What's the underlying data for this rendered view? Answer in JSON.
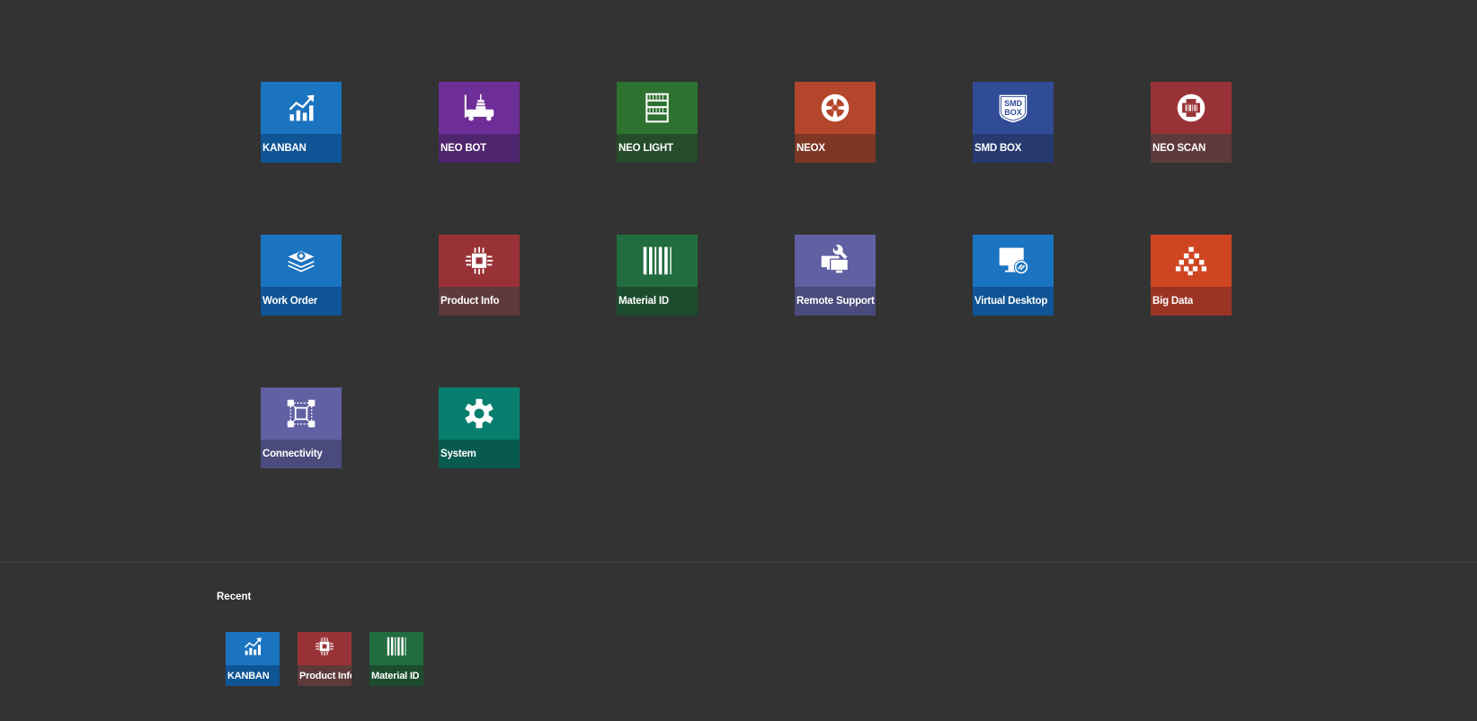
{
  "apps": [
    {
      "id": "kanban",
      "label": "KANBAN",
      "top": "#1b74c0",
      "bottom": "#0f5494",
      "icon": "chart-icon"
    },
    {
      "id": "neo-bot",
      "label": "NEO BOT",
      "top": "#6d2f97",
      "bottom": "#4f256d",
      "icon": "robot-icon"
    },
    {
      "id": "neo-light",
      "label": "NEO LIGHT",
      "top": "#2e7230",
      "bottom": "#244c29",
      "icon": "shelf-icon"
    },
    {
      "id": "neox",
      "label": "NEOX",
      "top": "#b4472b",
      "bottom": "#7e3625",
      "icon": "reel-icon"
    },
    {
      "id": "smd-box",
      "label": "SMD BOX",
      "top": "#304c97",
      "bottom": "#263a6f",
      "icon": "smd-box-icon"
    },
    {
      "id": "neo-scan",
      "label": "NEO SCAN",
      "top": "#993236",
      "bottom": "#5e3a3b",
      "icon": "scan-icon"
    },
    {
      "id": "work-order",
      "label": "Work Order",
      "top": "#1b74c0",
      "bottom": "#0f5494",
      "icon": "layers-icon"
    },
    {
      "id": "product-info",
      "label": "Product Info",
      "top": "#993236",
      "bottom": "#5e3a3b",
      "icon": "chip-icon"
    },
    {
      "id": "material-id",
      "label": "Material ID",
      "top": "#216d3f",
      "bottom": "#1c4c2e",
      "icon": "barcode-icon"
    },
    {
      "id": "remote-support",
      "label": "Remote Support",
      "top": "#6060a3",
      "bottom": "#4a4a7c",
      "icon": "remote-support-icon"
    },
    {
      "id": "virtual-desktop",
      "label": "Virtual Desktop",
      "top": "#1b74c0",
      "bottom": "#0f5494",
      "icon": "virtual-desktop-icon"
    },
    {
      "id": "big-data",
      "label": "Big Data",
      "top": "#d04521",
      "bottom": "#9b3424",
      "icon": "cubes-icon"
    },
    {
      "id": "connectivity",
      "label": "Connectivity",
      "top": "#6060a3",
      "bottom": "#4a4a7c",
      "icon": "connectivity-icon"
    },
    {
      "id": "system",
      "label": "System",
      "top": "#087f6e",
      "bottom": "#085a4f",
      "icon": "gear-icon"
    }
  ],
  "recent": {
    "title": "Recent",
    "items": [
      {
        "id": "kanban",
        "label": "KANBAN",
        "top": "#1b74c0",
        "bottom": "#0f5494",
        "icon": "chart-icon"
      },
      {
        "id": "product-info",
        "label": "Product Info",
        "top": "#993236",
        "bottom": "#5e3a3b",
        "icon": "chip-icon"
      },
      {
        "id": "material-id",
        "label": "Material ID",
        "top": "#216d3f",
        "bottom": "#1c4c2e",
        "icon": "barcode-icon"
      }
    ]
  }
}
